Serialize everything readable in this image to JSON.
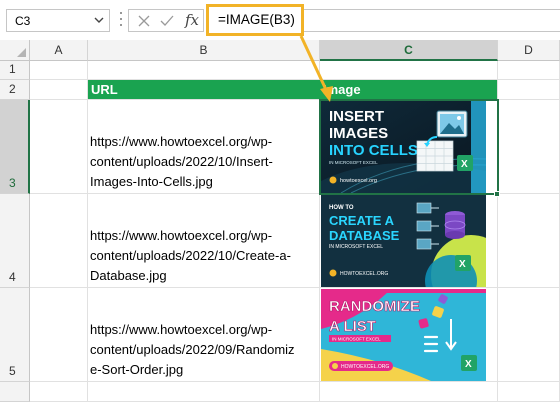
{
  "formula_bar": {
    "name_box": "C3",
    "formula": "=IMAGE(B3)",
    "fx_label": "fx"
  },
  "columns": [
    "A",
    "B",
    "C",
    "D"
  ],
  "rows": [
    "1",
    "2",
    "3",
    "4",
    "5"
  ],
  "header_row": {
    "url": "URL",
    "image": "Image"
  },
  "records": [
    {
      "url_lines": [
        "https://www.howtoexcel.org/wp-",
        "content/uploads/2022/10/Insert-",
        "Images-Into-Cells.jpg"
      ],
      "thumb": {
        "lines": [
          "INSERT",
          "IMAGES",
          "INTO CELLS"
        ],
        "sub": "IN MICROSOFT EXCEL",
        "site": "howtoexcel.org"
      }
    },
    {
      "url_lines": [
        "https://www.howtoexcel.org/wp-",
        "content/uploads/2022/10/Create-a-",
        "Database.jpg"
      ],
      "thumb": {
        "lines": [
          "HOW TO",
          "CREATE A",
          "DATABASE"
        ],
        "sub": "IN MICROSOFT EXCEL",
        "site": "HOWTOEXCEL.ORG"
      }
    },
    {
      "url_lines": [
        "https://www.howtoexcel.org/wp-",
        "content/uploads/2022/09/Randomiz",
        "e-Sort-Order.jpg"
      ],
      "thumb": {
        "lines": [
          "RANDOMIZE",
          "A LIST"
        ],
        "sub": "IN MICROSOFT EXCEL",
        "site": "HOWTOEXCEL.ORG"
      }
    }
  ],
  "colors": {
    "header_green": "#1aa350",
    "selection_green": "#217346",
    "callout_orange": "#f2b327"
  }
}
